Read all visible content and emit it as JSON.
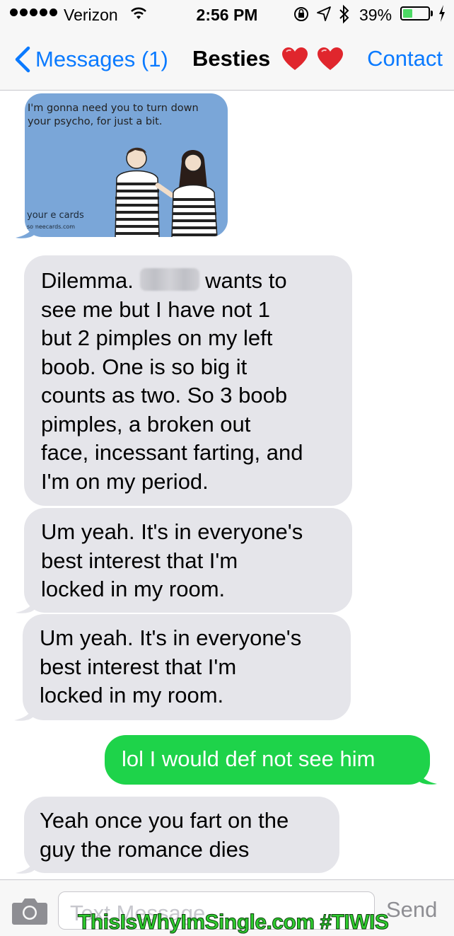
{
  "status_bar": {
    "carrier": "Verizon",
    "time": "2:56 PM",
    "battery_text": "39%",
    "battery_level": 0.39,
    "battery_color": "#4cd964"
  },
  "nav": {
    "back_label": "Messages (1)",
    "title": "Besties",
    "title_icons": [
      "heart-icon",
      "heart-icon"
    ],
    "contact_label": "Contact",
    "accent_color": "#0a7aff"
  },
  "ecard": {
    "caption_line1": "I'm gonna need you to turn down",
    "caption_line2": "your psycho, for just a bit.",
    "logo": "your e cards",
    "logo_sub": "someecards.com"
  },
  "messages": [
    {
      "direction": "incoming",
      "lines": [
        "Dilemma. [name] wants to",
        "see me but I have not 1",
        "but 2 pimples on my left",
        "boob. One is so big it",
        "counts as two. So 3 boob",
        "pimples, a broken out",
        "face, incessant farting, and",
        "I'm on my period."
      ],
      "line1_before": "Dilemma.",
      "line1_after": "wants to"
    },
    {
      "direction": "incoming",
      "lines": [
        "Um yeah. It's in everyone's",
        "best interest that I'm",
        "locked in my room."
      ]
    },
    {
      "direction": "incoming",
      "lines": [
        "Um yeah. It's in everyone's",
        "best interest that I'm",
        "locked in my room."
      ]
    },
    {
      "direction": "outgoing",
      "lines": [
        "lol I would def not see him"
      ]
    },
    {
      "direction": "incoming",
      "lines": [
        "Yeah once you fart on the",
        "guy the romance dies"
      ]
    }
  ],
  "input_bar": {
    "placeholder": "Text Message",
    "send_label": "Send"
  },
  "watermark": "ThisIsWhyImSingle.com  #TIWIS",
  "colors": {
    "incoming_bubble": "#e5e5ea",
    "outgoing_bubble": "#1ed34a",
    "watermark": "#2ecc2e"
  }
}
